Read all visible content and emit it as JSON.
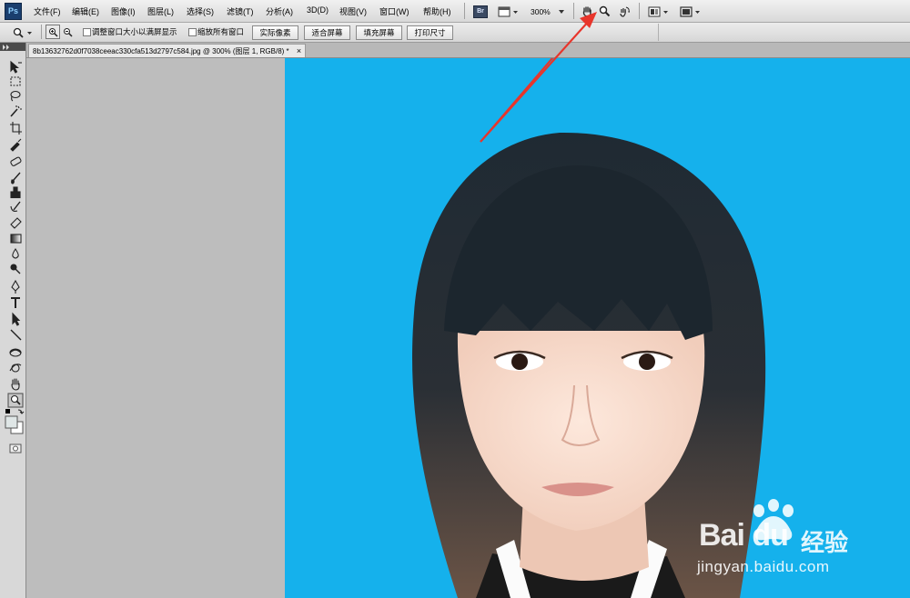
{
  "app": {
    "logo": "Ps"
  },
  "menu": [
    {
      "id": "file",
      "label": "文件(F)"
    },
    {
      "id": "edit",
      "label": "编辑(E)"
    },
    {
      "id": "image",
      "label": "图像(I)"
    },
    {
      "id": "layer",
      "label": "图层(L)"
    },
    {
      "id": "select",
      "label": "选择(S)"
    },
    {
      "id": "filter",
      "label": "滤镜(T)"
    },
    {
      "id": "analysis",
      "label": "分析(A)"
    },
    {
      "id": "3d",
      "label": "3D(D)"
    },
    {
      "id": "view",
      "label": "视图(V)"
    },
    {
      "id": "window",
      "label": "窗口(W)"
    },
    {
      "id": "help",
      "label": "帮助(H)"
    }
  ],
  "appbar": {
    "bridge_label": "Br",
    "zoom_level": "300%",
    "icons": [
      "bridge-icon",
      "minibridge-icon",
      "zoom-level-dropdown",
      "hand-tool-icon",
      "zoom-tool-icon",
      "rotate-view-icon",
      "arrange-documents-icon",
      "screen-mode-icon"
    ]
  },
  "options": {
    "resize_windows_label": "调整窗口大小以满屏显示",
    "zoom_all_windows_label": "缩放所有窗口",
    "actual_pixels": "实际像素",
    "fit_screen": "适合屏幕",
    "fill_screen": "填充屏幕",
    "print_size": "打印尺寸"
  },
  "document": {
    "tab_title": "8b13632762d0f7038ceeac330cfa513d2797c584.jpg @ 300% (图层 1, RGB/8) *",
    "close": "×"
  },
  "colors": {
    "photo_background": "#15b1ec",
    "annotation_arrow": "#e8352b",
    "workspace": "#bdbdbd"
  },
  "watermark": {
    "brand": "Bai du",
    "brand_cn": "经验",
    "url": "jingyan.baidu.com"
  },
  "tools": [
    "move-tool-icon",
    "marquee-tool-icon",
    "lasso-tool-icon",
    "magic-wand-tool-icon",
    "crop-tool-icon",
    "eyedropper-tool-icon",
    "spot-healing-tool-icon",
    "brush-tool-icon",
    "clone-stamp-tool-icon",
    "history-brush-tool-icon",
    "eraser-tool-icon",
    "gradient-tool-icon",
    "blur-tool-icon",
    "dodge-tool-icon",
    "pen-tool-icon",
    "type-tool-icon",
    "path-selection-tool-icon",
    "line-tool-icon",
    "3d-rotate-tool-icon",
    "3d-orbit-tool-icon",
    "hand-tool-icon",
    "zoom-tool-icon",
    "color-swatches",
    "quick-mask-icon"
  ]
}
